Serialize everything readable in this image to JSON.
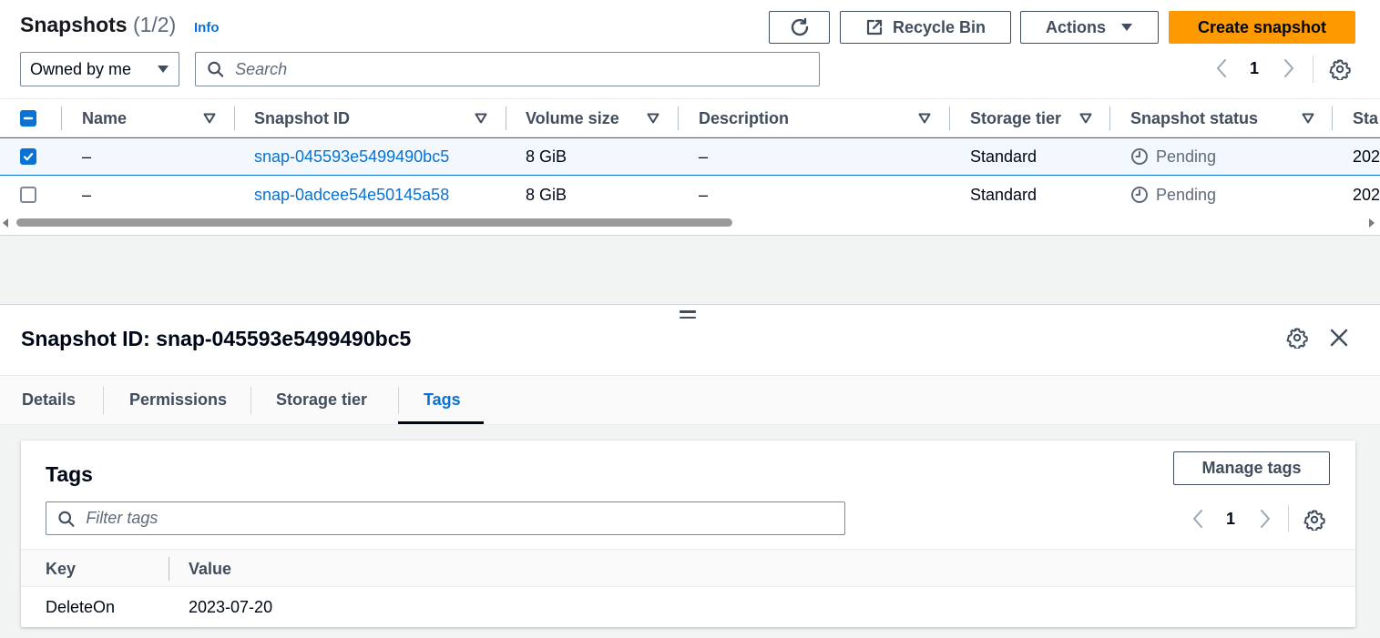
{
  "header": {
    "title": "Snapshots",
    "count": "(1/2)",
    "info_label": "Info",
    "recycle_bin_label": "Recycle Bin",
    "actions_label": "Actions",
    "create_label": "Create snapshot"
  },
  "filter": {
    "owner_selected": "Owned by me",
    "search_placeholder": "Search"
  },
  "pagination": {
    "page": "1"
  },
  "table": {
    "columns": [
      "Name",
      "Snapshot ID",
      "Volume size",
      "Description",
      "Storage tier",
      "Snapshot status",
      "Sta"
    ],
    "rows": [
      {
        "selected": true,
        "name": "–",
        "snapshot_id": "snap-045593e5499490bc5",
        "volume_size": "8 GiB",
        "description": "–",
        "storage_tier": "Standard",
        "status": "Pending",
        "started": "202"
      },
      {
        "selected": false,
        "name": "–",
        "snapshot_id": "snap-0adcee54e50145a58",
        "volume_size": "8 GiB",
        "description": "–",
        "storage_tier": "Standard",
        "status": "Pending",
        "started": "202"
      }
    ]
  },
  "details_panel": {
    "title": "Snapshot ID: snap-045593e5499490bc5",
    "tabs": [
      "Details",
      "Permissions",
      "Storage tier",
      "Tags"
    ],
    "active_tab": "Tags"
  },
  "tags": {
    "title": "Tags",
    "manage_label": "Manage tags",
    "filter_placeholder": "Filter tags",
    "page": "1",
    "columns": [
      "Key",
      "Value"
    ],
    "rows": [
      {
        "key": "DeleteOn",
        "value": "2023-07-20"
      }
    ]
  },
  "colors": {
    "primary_button": "#ff9900",
    "link": "#0972d3",
    "text": "#000716",
    "muted": "#5f6b7a",
    "selected_row_bg": "#f2f8fd",
    "panel_bg": "#f2f3f3"
  }
}
